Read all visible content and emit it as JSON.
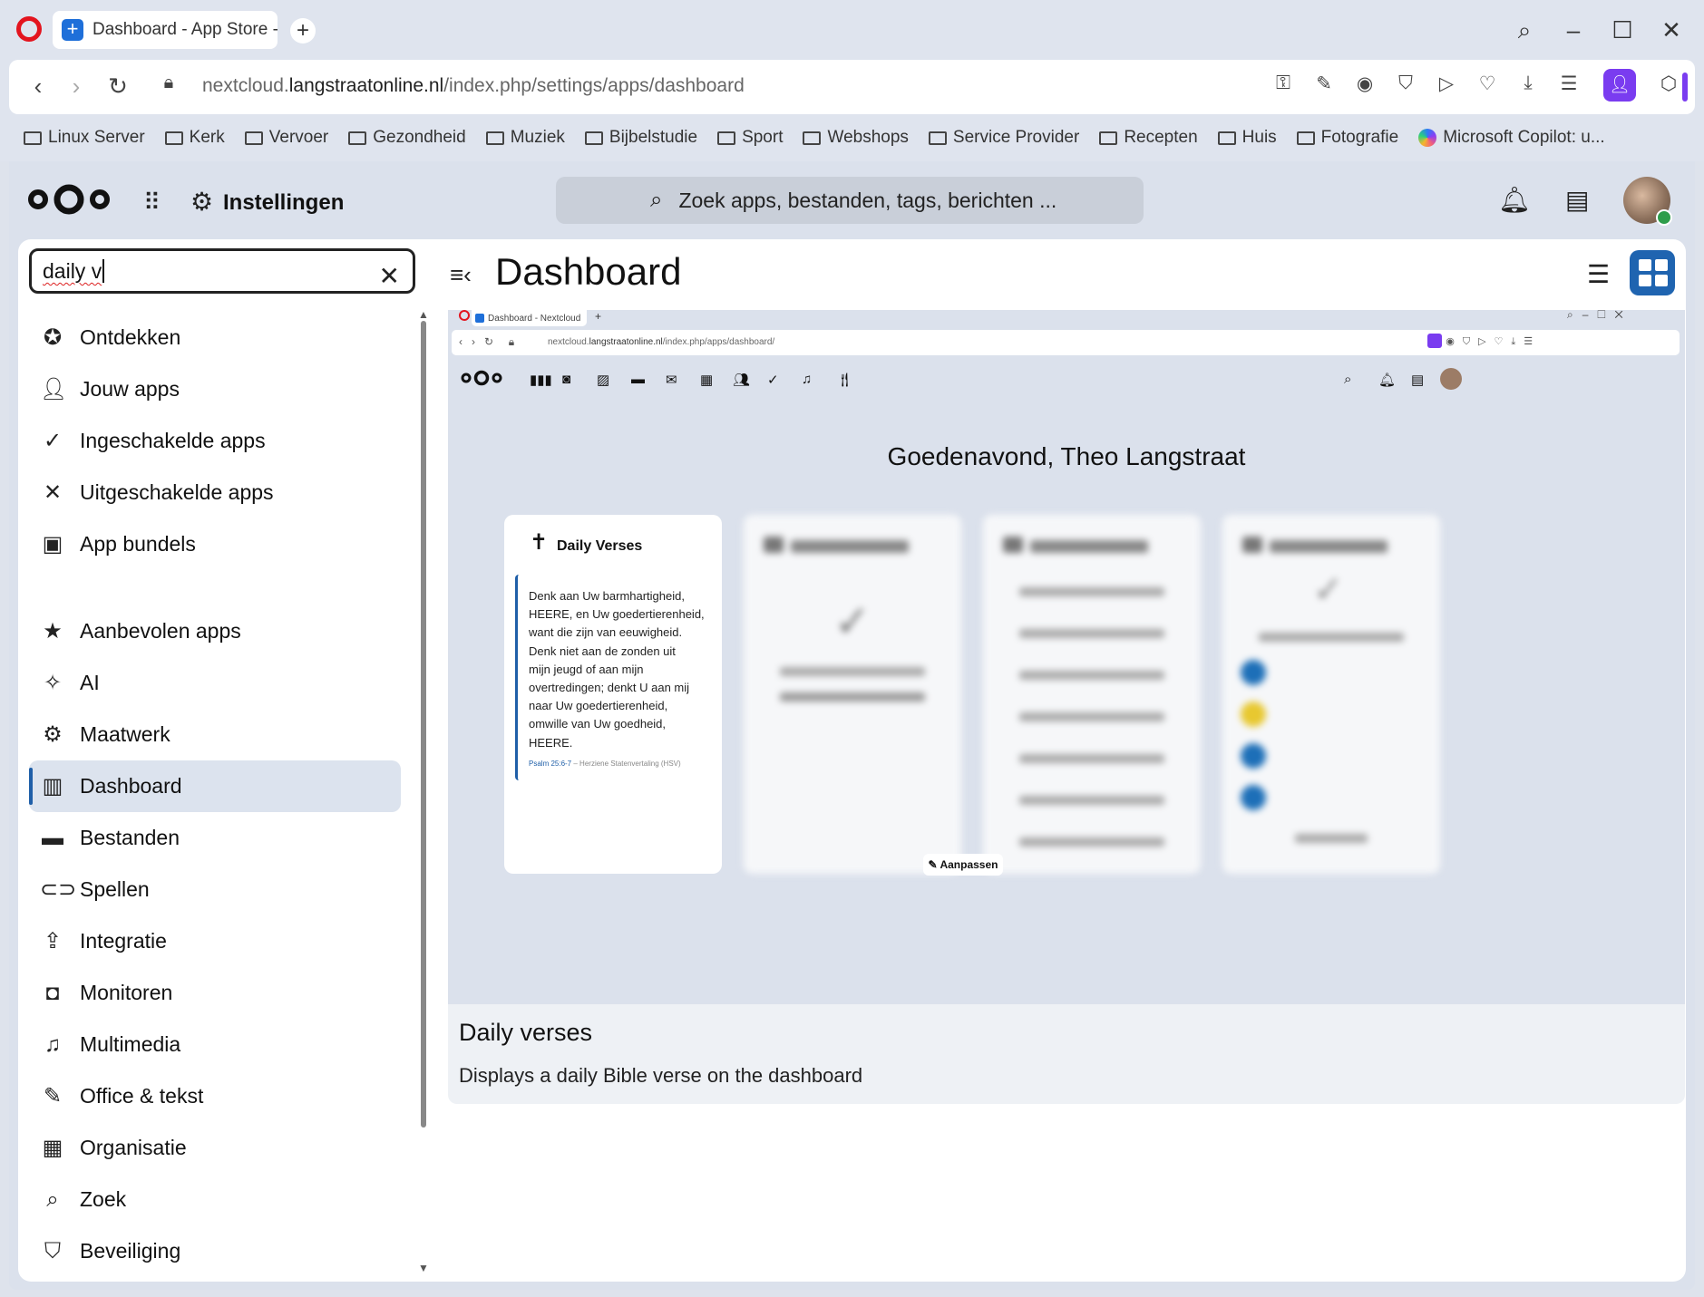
{
  "browser": {
    "tab_title": "Dashboard - App Store - N",
    "url_prefix": "nextcloud.",
    "url_domain": "langstraatonline.nl",
    "url_path": "/index.php/settings/apps/dashboard",
    "bookmarks": [
      "Linux Server",
      "Kerk",
      "Vervoer",
      "Gezondheid",
      "Muziek",
      "Bijbelstudie",
      "Sport",
      "Webshops",
      "Service Provider",
      "Recepten",
      "Huis",
      "Fotografie"
    ],
    "copilot_bookmark": "Microsoft Copilot: u..."
  },
  "header": {
    "settings_label": "Instellingen",
    "search_placeholder": "Zoek apps, bestanden, tags, berichten ..."
  },
  "sidebar": {
    "search_value": "daily v",
    "items_top": [
      {
        "label": "Ontdekken",
        "icon": "star-circle-icon"
      },
      {
        "label": "Jouw apps",
        "icon": "user-icon"
      },
      {
        "label": "Ingeschakelde apps",
        "icon": "check-icon"
      },
      {
        "label": "Uitgeschakelde apps",
        "icon": "close-icon"
      },
      {
        "label": "App bundels",
        "icon": "archive-icon"
      }
    ],
    "items_categories": [
      {
        "label": "Aanbevolen apps",
        "icon": "star-icon"
      },
      {
        "label": "AI",
        "icon": "sparkle-icon"
      },
      {
        "label": "Maatwerk",
        "icon": "gear-icon"
      },
      {
        "label": "Dashboard",
        "icon": "dashboard-icon",
        "active": true
      },
      {
        "label": "Bestanden",
        "icon": "folder-icon"
      },
      {
        "label": "Spellen",
        "icon": "gamepad-icon"
      },
      {
        "label": "Integratie",
        "icon": "upload-box-icon"
      },
      {
        "label": "Monitoren",
        "icon": "monitor-eye-icon"
      },
      {
        "label": "Multimedia",
        "icon": "multimedia-icon"
      },
      {
        "label": "Office & tekst",
        "icon": "document-edit-icon"
      },
      {
        "label": "Organisatie",
        "icon": "office-building-icon"
      },
      {
        "label": "Zoek",
        "icon": "magnify-icon"
      },
      {
        "label": "Beveiliging",
        "icon": "shield-icon"
      }
    ]
  },
  "main": {
    "title": "Dashboard",
    "app_name": "Daily verses",
    "app_description": "Displays a daily Bible verse on the dashboard"
  },
  "screenshot": {
    "tab_title": "Dashboard - Nextcloud",
    "url_prefix": "nextcloud.",
    "url_domain": "langstraatonline.nl",
    "url_path": "/index.php/apps/dashboard/",
    "greeting": "Goedenavond, Theo Langstraat",
    "widget_title": "Daily Verses",
    "verse_text": "Denk aan Uw barmhartigheid,\nHEERE, en Uw goedertierenheid,\nwant die zijn van eeuwigheid.\nDenk niet aan de zonden uit\nmijn jeugd of aan mijn\novertredingen; denkt U aan mij\nnaar Uw goedertierenheid,\nomwille van Uw goedheid,\nHEERE.",
    "verse_ref": "Psalm 25:6-7",
    "verse_translation": "– Herziene Statenvertaling (HSV)",
    "customize_label": "Aanpassen"
  },
  "colors": {
    "accent": "#1f64b0",
    "opera_red": "#e3141e",
    "profile_purple": "#7a3cf0"
  }
}
